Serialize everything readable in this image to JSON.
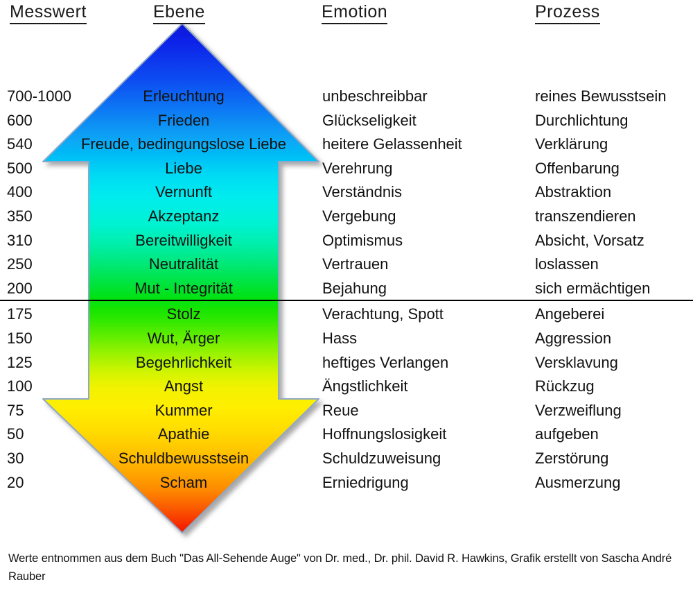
{
  "headers": {
    "messwert": "Messwert",
    "ebene": "Ebene",
    "emotion": "Emotion",
    "prozess": "Prozess"
  },
  "colors": {
    "arrow_top": "#0a1ee6",
    "arrow_blue": "#0a8cf0",
    "arrow_cyan": "#00e6f0",
    "arrow_aqua": "#00f5d8",
    "arrow_green": "#00e000",
    "arrow_yellow_green": "#b4f000",
    "arrow_yellow": "#ffee00",
    "arrow_gold": "#ffc800",
    "arrow_orange": "#ff8c00",
    "arrow_red": "#f52000",
    "arrow_outline": "#8fa8c8",
    "divider": "#000000",
    "text": "#111111"
  },
  "rows": [
    {
      "value": "700-1000",
      "level": "Erleuchtung",
      "emotion": "unbeschreibbar",
      "process": "reines Bewusstsein"
    },
    {
      "value": "600",
      "level": "Frieden",
      "emotion": "Glückseligkeit",
      "process": "Durchlichtung"
    },
    {
      "value": "540",
      "level": "Freude, bedingungslose Liebe",
      "emotion": "heitere Gelassenheit",
      "process": "Verklärung"
    },
    {
      "value": "500",
      "level": "Liebe",
      "emotion": "Verehrung",
      "process": "Offenbarung"
    },
    {
      "value": "400",
      "level": "Vernunft",
      "emotion": "Verständnis",
      "process": "Abstraktion"
    },
    {
      "value": "350",
      "level": "Akzeptanz",
      "emotion": "Vergebung",
      "process": "transzendieren"
    },
    {
      "value": "310",
      "level": "Bereitwilligkeit",
      "emotion": "Optimismus",
      "process": "Absicht, Vorsatz"
    },
    {
      "value": "250",
      "level": "Neutralität",
      "emotion": "Vertrauen",
      "process": "loslassen"
    },
    {
      "value": "200",
      "level": "Mut - Integrität",
      "emotion": "Bejahung",
      "process": "sich ermächtigen"
    },
    {
      "value": "175",
      "level": "Stolz",
      "emotion": "Verachtung, Spott",
      "process": "Angeberei"
    },
    {
      "value": "150",
      "level": "Wut, Ärger",
      "emotion": "Hass",
      "process": "Aggression"
    },
    {
      "value": "125",
      "level": "Begehrlichkeit",
      "emotion": "heftiges Verlangen",
      "process": "Versklavung"
    },
    {
      "value": "100",
      "level": "Angst",
      "emotion": "Ängstlichkeit",
      "process": "Rückzug"
    },
    {
      "value": "75",
      "level": "Kummer",
      "emotion": "Reue",
      "process": "Verzweiflung"
    },
    {
      "value": "50",
      "level": "Apathie",
      "emotion": "Hoffnungslosigkeit",
      "process": "aufgeben"
    },
    {
      "value": "30",
      "level": "Schuldbewusstsein",
      "emotion": "Schuldzuweisung",
      "process": "Zerstörung"
    },
    {
      "value": "20",
      "level": "Scham",
      "emotion": "Erniedrigung",
      "process": "Ausmerzung"
    }
  ],
  "footnote": "Werte entnommen aus dem Buch \"Das All-Sehende Auge\" von Dr. med., Dr. phil. David R. Hawkins, Grafik erstellt von Sascha André Rauber"
}
